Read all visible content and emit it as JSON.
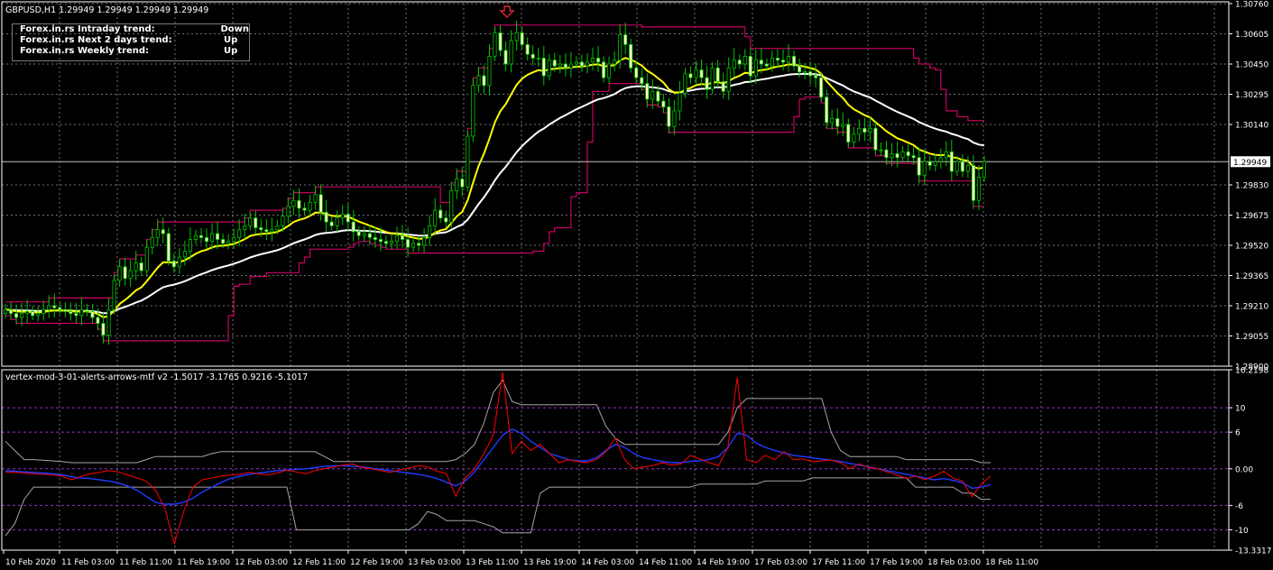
{
  "header": {
    "title": "GBPUSD,H1  1.29949 1.29949 1.29949 1.29949"
  },
  "trend_box": {
    "rows": [
      {
        "label": "Forex.in.rs Intraday trend:",
        "value": "Down"
      },
      {
        "label": "Forex.in.rs Next 2 days trend:",
        "value": "Up"
      },
      {
        "label": "Forex.in.rs Weekly trend:",
        "value": "Up"
      }
    ]
  },
  "indicator": {
    "title": "vertex-mod-3-01-alerts-arrows-mtf v2 -1.5017 -3.1765 0.9216 -5.1017"
  },
  "colors": {
    "background": "#000000",
    "grid": "#6f6f6f",
    "candle_up": "#00c400",
    "candle_down_body": "#ffffbe",
    "fast_ma": "#ffff00",
    "slow_ma": "#ffffff",
    "channel": "#c80064",
    "osc_red": "#ff0000",
    "osc_blue": "#1e3cff",
    "osc_band": "#a6a6a6",
    "level_line": "#9632c8",
    "current_price_bg": "#ffffff"
  },
  "chart_data": [
    {
      "type": "candlestick",
      "symbol": "GBPUSD",
      "timeframe": "H1",
      "y_ticks": [
        "1.30760",
        "1.30605",
        "1.30450",
        "1.30295",
        "1.30140",
        "1.29830",
        "1.29675",
        "1.29520",
        "1.29365",
        "1.29210",
        "1.29055",
        "1.28900"
      ],
      "ylim": [
        1.289,
        1.3076
      ],
      "current_price": "1.29949",
      "x_ticks": [
        "10 Feb 2020",
        "11 Feb 03:00",
        "11 Feb 11:00",
        "11 Feb 19:00",
        "12 Feb 03:00",
        "12 Feb 11:00",
        "12 Feb 19:00",
        "13 Feb 03:00",
        "13 Feb 11:00",
        "13 Feb 19:00",
        "14 Feb 03:00",
        "14 Feb 11:00",
        "14 Feb 19:00",
        "17 Feb 03:00",
        "17 Feb 11:00",
        "17 Feb 19:00",
        "18 Feb 03:00",
        "18 Feb 11:00"
      ],
      "close": [
        1.2919,
        1.2917,
        1.2915,
        1.2917,
        1.2918,
        1.2916,
        1.2917,
        1.2919,
        1.2921,
        1.292,
        1.2919,
        1.2918,
        1.2917,
        1.2916,
        1.2919,
        1.2918,
        1.2915,
        1.2912,
        1.2906,
        1.2919,
        1.2934,
        1.2941,
        1.2935,
        1.2939,
        1.2943,
        1.2939,
        1.2951,
        1.2956,
        1.296,
        1.2958,
        1.2944,
        1.2941,
        1.2946,
        1.2949,
        1.2955,
        1.2957,
        1.2956,
        1.2954,
        1.2958,
        1.2955,
        1.2953,
        1.2954,
        1.2956,
        1.296,
        1.2962,
        1.2966,
        1.2961,
        1.296,
        1.2959,
        1.296,
        1.2962,
        1.2967,
        1.2972,
        1.2975,
        1.2971,
        1.297,
        1.2974,
        1.2978,
        1.2969,
        1.2964,
        1.2962,
        1.2966,
        1.2968,
        1.2964,
        1.2959,
        1.2957,
        1.2958,
        1.2956,
        1.2955,
        1.2954,
        1.2953,
        1.2954,
        1.2957,
        1.2955,
        1.2951,
        1.2953,
        1.2952,
        1.2956,
        1.2962,
        1.297,
        1.2966,
        1.2964,
        1.298,
        1.2986,
        1.2982,
        1.3008,
        1.3034,
        1.3039,
        1.3034,
        1.3049,
        1.3061,
        1.3052,
        1.3045,
        1.3057,
        1.3061,
        1.3055,
        1.305,
        1.3048,
        1.3048,
        1.3039,
        1.3047,
        1.3044,
        1.3045,
        1.3043,
        1.3045,
        1.3046,
        1.3044,
        1.3046,
        1.3048,
        1.3046,
        1.3038,
        1.3045,
        1.3047,
        1.306,
        1.3055,
        1.3043,
        1.3038,
        1.3035,
        1.3027,
        1.3031,
        1.3026,
        1.3023,
        1.3013,
        1.3021,
        1.303,
        1.304,
        1.3038,
        1.3042,
        1.3038,
        1.3032,
        1.3043,
        1.3036,
        1.3031,
        1.3043,
        1.3047,
        1.3045,
        1.3049,
        1.3039,
        1.3047,
        1.3045,
        1.3044,
        1.3048,
        1.3047,
        1.3046,
        1.3049,
        1.3044,
        1.3041,
        1.3041,
        1.3039,
        1.3038,
        1.3028,
        1.3015,
        1.3017,
        1.3013,
        1.3014,
        1.3005,
        1.3009,
        1.3012,
        1.301,
        1.3012,
        1.3001,
        1.3001,
        1.2997,
        1.2999,
        1.2997,
        1.3,
        1.2998,
        1.2997,
        1.2988,
        1.2995,
        1.2993,
        1.2995,
        1.2997,
        1.3,
        1.299,
        1.2995,
        1.299,
        1.2993,
        1.2975,
        1.2987,
        1.2995
      ]
    },
    {
      "type": "line",
      "name": "vertex-mod-3-01-alerts-arrows-mtf v2",
      "y_ticks": [
        "16.2198",
        "10",
        "6",
        "0.00",
        "-6",
        "-10",
        "-13.3317"
      ],
      "ylim": [
        -13.3317,
        16.2198
      ],
      "levels": [
        10,
        6,
        0,
        -6,
        -10
      ],
      "series": [
        {
          "values": [
            -0.5,
            -0.6,
            -0.7,
            -0.8,
            -0.9,
            -1.0,
            -1.2,
            -1.8,
            -1.3,
            -0.8,
            -0.6,
            -0.3,
            -0.5,
            -1.0,
            -1.5,
            -2.0,
            -3.5,
            -6.5,
            -12.3,
            -7.0,
            -3.0,
            -1.8,
            -1.5,
            -1.2,
            -1.0,
            -0.9,
            -0.6,
            -0.8,
            -1.0,
            -0.7,
            -0.2,
            -0.5,
            -0.8,
            -0.3,
            0.0,
            0.3,
            0.6,
            0.8,
            0.2,
            0.0,
            -0.3,
            -0.6,
            -0.2,
            0.1,
            0.5,
            0.3,
            -0.4,
            -0.8,
            -4.5,
            -1.5,
            0.0,
            2.5,
            5.5,
            15.8,
            2.5,
            4.5,
            3.0,
            4.0,
            2.5,
            1.0,
            1.5,
            1.2,
            1.0,
            1.5,
            2.8,
            5.0,
            1.5,
            0.0,
            0.3,
            0.5,
            1.0,
            0.6,
            0.8,
            2.2,
            1.6,
            1.0,
            0.5,
            3.5,
            15.0,
            1.5,
            1.0,
            2.2,
            1.5,
            2.8,
            1.5,
            1.6,
            1.2,
            1.3,
            1.4,
            1.0,
            0.0,
            0.8,
            0.2,
            0.0,
            -0.5,
            -1.0,
            -1.6,
            -1.2,
            -1.8,
            -1.2,
            -0.4,
            -1.5,
            -2.0,
            -4.6,
            -2.5,
            -1.2
          ]
        },
        {
          "values": [
            -0.3,
            -0.4,
            -0.5,
            -0.6,
            -0.7,
            -0.8,
            -1.0,
            -1.3,
            -1.5,
            -1.6,
            -1.8,
            -2.0,
            -2.3,
            -2.8,
            -3.5,
            -4.5,
            -5.5,
            -5.8,
            -5.8,
            -5.5,
            -4.8,
            -3.8,
            -3.0,
            -2.2,
            -1.6,
            -1.2,
            -0.9,
            -0.7,
            -0.5,
            -0.3,
            -0.2,
            -0.1,
            0.0,
            0.2,
            0.4,
            0.5,
            0.5,
            0.4,
            0.3,
            0.1,
            -0.1,
            -0.3,
            -0.5,
            -0.7,
            -0.9,
            -1.2,
            -1.6,
            -2.2,
            -2.8,
            -2.0,
            -0.5,
            1.5,
            3.5,
            5.5,
            6.5,
            5.8,
            4.5,
            3.5,
            2.5,
            2.0,
            1.5,
            1.3,
            1.3,
            1.8,
            3.0,
            4.0,
            3.5,
            2.5,
            1.8,
            1.5,
            1.2,
            1.0,
            1.0,
            1.2,
            1.3,
            1.5,
            2.0,
            3.5,
            5.8,
            5.5,
            4.2,
            3.5,
            3.0,
            2.6,
            2.2,
            2.0,
            1.8,
            1.6,
            1.4,
            1.2,
            0.9,
            0.6,
            0.3,
            0.0,
            -0.3,
            -0.6,
            -0.9,
            -1.2,
            -1.5,
            -1.8,
            -1.6,
            -1.9,
            -2.3,
            -3.2,
            -3.0,
            -2.6
          ]
        },
        {
          "values": [
            4.5,
            3.0,
            1.5,
            1.5,
            1.4,
            1.3,
            1.2,
            1.0,
            1.0,
            1.0,
            1.0,
            1.0,
            1.0,
            1.0,
            1.0,
            1.5,
            2.0,
            2.0,
            2.0,
            2.0,
            2.0,
            2.0,
            2.5,
            2.8,
            2.8,
            2.8,
            2.8,
            2.8,
            2.8,
            2.8,
            2.8,
            2.8,
            2.8,
            2.8,
            2.0,
            1.2,
            1.2,
            1.2,
            1.2,
            1.2,
            1.2,
            1.2,
            1.2,
            1.2,
            1.2,
            1.2,
            1.2,
            1.2,
            1.5,
            2.5,
            4.0,
            7.5,
            12.5,
            14.5,
            11.0,
            10.5,
            10.5,
            10.5,
            10.5,
            10.5,
            10.5,
            10.5,
            10.5,
            10.5,
            7.0,
            5.0,
            4.0,
            4.0,
            4.0,
            4.0,
            4.0,
            4.0,
            4.0,
            4.0,
            4.0,
            4.0,
            4.0,
            6.0,
            10.0,
            11.5,
            11.5,
            11.5,
            11.5,
            11.5,
            11.5,
            11.5,
            11.5,
            11.5,
            6.0,
            3.0,
            2.0,
            2.0,
            2.0,
            2.0,
            2.0,
            2.0,
            1.5,
            1.5,
            1.5,
            1.5,
            1.5,
            1.5,
            1.5,
            1.5,
            1.0,
            1.0
          ]
        },
        {
          "values": [
            -11.0,
            -9.0,
            -5.0,
            -3.0,
            -3.0,
            -3.0,
            -3.0,
            -3.0,
            -3.0,
            -3.0,
            -3.0,
            -3.0,
            -3.0,
            -3.0,
            -3.0,
            -3.0,
            -3.0,
            -3.0,
            -3.0,
            -3.0,
            -3.0,
            -3.0,
            -3.0,
            -3.0,
            -3.0,
            -3.0,
            -3.0,
            -3.0,
            -3.0,
            -3.0,
            -3.0,
            -10.0,
            -10.0,
            -10.0,
            -10.0,
            -10.0,
            -10.0,
            -10.0,
            -10.0,
            -10.0,
            -10.0,
            -10.0,
            -10.0,
            -10.0,
            -9.0,
            -7.0,
            -7.5,
            -8.5,
            -8.5,
            -8.5,
            -8.5,
            -9.0,
            -9.5,
            -10.5,
            -10.5,
            -10.5,
            -10.5,
            -4.0,
            -3.0,
            -3.0,
            -3.0,
            -3.0,
            -3.0,
            -3.0,
            -3.0,
            -3.0,
            -3.0,
            -3.0,
            -3.0,
            -3.0,
            -3.0,
            -3.0,
            -3.0,
            -3.0,
            -2.5,
            -2.5,
            -2.5,
            -2.5,
            -2.5,
            -2.5,
            -2.5,
            -2.0,
            -2.0,
            -2.0,
            -2.0,
            -2.0,
            -1.5,
            -1.5,
            -1.5,
            -1.5,
            -1.5,
            -1.5,
            -1.5,
            -1.5,
            -1.5,
            -1.5,
            -1.5,
            -3.0,
            -3.0,
            -3.0,
            -3.0,
            -3.0,
            -4.0,
            -4.0,
            -5.0,
            -5.0
          ]
        }
      ]
    }
  ]
}
